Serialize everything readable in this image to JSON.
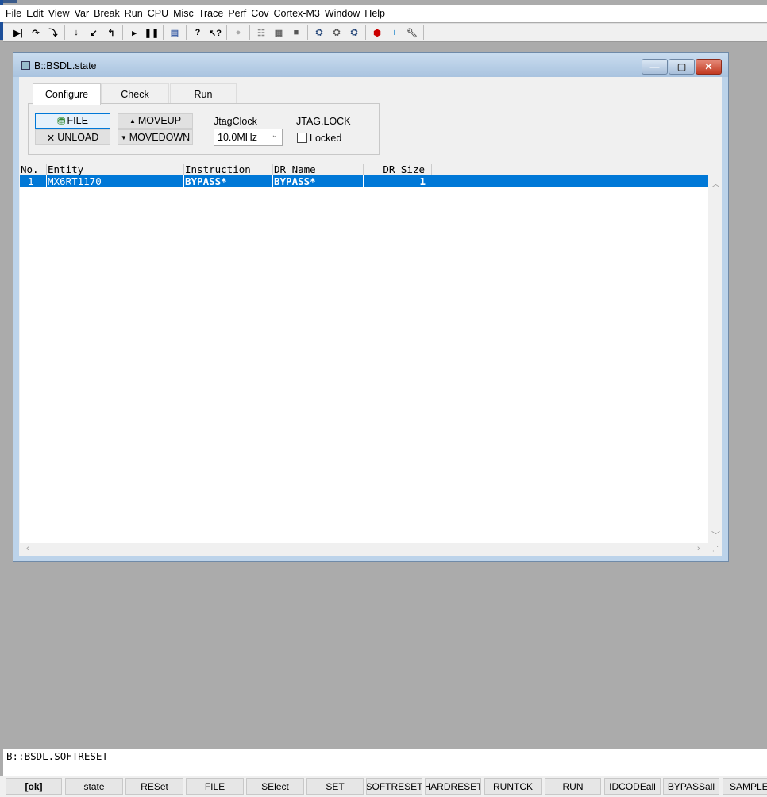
{
  "menu": [
    "File",
    "Edit",
    "View",
    "Var",
    "Break",
    "Run",
    "CPU",
    "Misc",
    "Trace",
    "Perf",
    "Cov",
    "Cortex-M3",
    "Window",
    "Help"
  ],
  "toolbar_icons": [
    "step-icon",
    "step-over-icon",
    "step-into-icon",
    "down-icon",
    "return-icon",
    "up-icon",
    "go-icon",
    "break-icon",
    "list-icon",
    "help-icon",
    "context-help-icon",
    "stop-icon",
    "register-icon",
    "memory-icon",
    "chip-icon",
    "view1-icon",
    "view2-icon",
    "view3-icon",
    "cube-icon",
    "info-icon",
    "wrench-icon"
  ],
  "window": {
    "title": "B::BSDL.state"
  },
  "tabs": [
    "Configure",
    "Check",
    "Run"
  ],
  "buttons": {
    "file": "FILE",
    "unload": "UNLOAD",
    "moveup": "MOVEUP",
    "movedown": "MOVEDOWN"
  },
  "jtag": {
    "clock_label": "JtagClock",
    "clock_value": "10.0MHz",
    "lock_label": "JTAG.LOCK",
    "locked_label": "Locked",
    "locked": false
  },
  "table": {
    "columns": [
      "No.",
      "Entity",
      "Instruction",
      "DR Name",
      "DR Size"
    ],
    "rows": [
      {
        "no": "1",
        "entity": "MX6RT1170",
        "instruction": "BYPASS*",
        "dr_name": "BYPASS*",
        "dr_size": "1"
      }
    ]
  },
  "command": "B::BSDL.SOFTRESET",
  "bottom_buttons": [
    "[ok]",
    "state",
    "RESet",
    "FILE",
    "SElect",
    "SET",
    "SOFTRESET",
    "HARDRESET",
    "RUNTCK",
    "RUN",
    "IDCODEall",
    "BYPASSall",
    "SAMPLEall"
  ],
  "colors": {
    "selection": "#0078d7",
    "close": "#c9462c"
  }
}
